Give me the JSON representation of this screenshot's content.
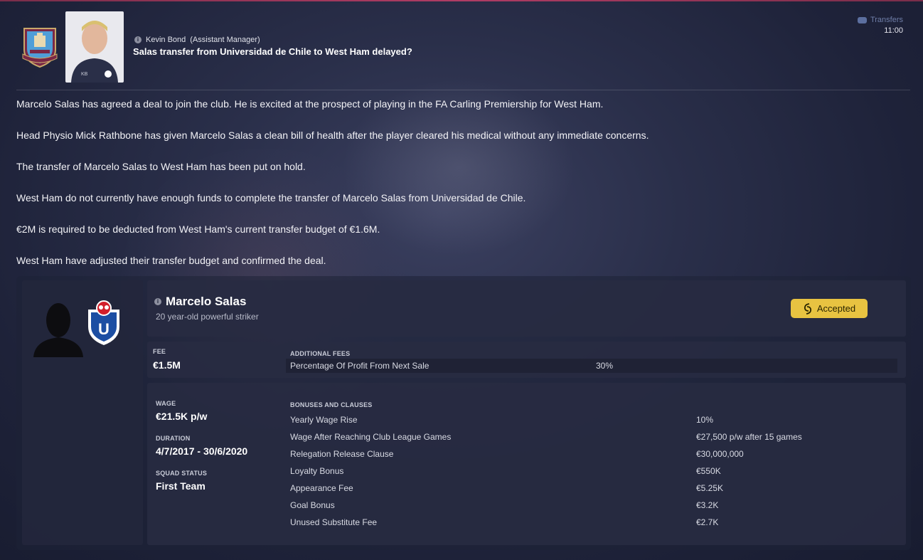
{
  "header": {
    "author_name": "Kevin Bond",
    "author_role": "(Assistant Manager)",
    "headline": "Salas transfer from Universidad de Chile to West Ham delayed?",
    "category": "Transfers",
    "time": "11:00",
    "club_badge_text": "WEST HAM UNITED",
    "staff_initials": "KB"
  },
  "body": {
    "paragraphs": [
      "Marcelo Salas has agreed a deal to join the club. He is excited at the prospect of playing in the FA Carling Premiership for West Ham.",
      "Head Physio Mick Rathbone has given Marcelo Salas a clean bill of health after the player cleared his medical without any immediate concerns.",
      "The transfer of Marcelo Salas to West Ham has been put on hold.",
      "West Ham do not currently have enough funds to complete the transfer of Marcelo Salas from Universidad de Chile.",
      "€2M is required to be deducted from West Ham's current transfer budget of €1.6M.",
      "West Ham have adjusted their transfer budget and confirmed the deal."
    ]
  },
  "player": {
    "name": "Marcelo Salas",
    "description": "20 year-old powerful striker",
    "status": "Accepted",
    "club_badge_letter": "U"
  },
  "fee": {
    "fee_label": "FEE",
    "fee_value": "€1.5M",
    "additional_label": "ADDITIONAL FEES",
    "additional_item": "Percentage Of Profit From Next Sale",
    "additional_value": "30%"
  },
  "contract": {
    "wage_label": "WAGE",
    "wage_value": "€21.5K p/w",
    "duration_label": "DURATION",
    "duration_value": "4/7/2017 - 30/6/2020",
    "squad_label": "SQUAD STATUS",
    "squad_value": "First Team",
    "clauses_label": "BONUSES AND CLAUSES",
    "clauses": [
      {
        "label": "Yearly Wage Rise",
        "value": "10%"
      },
      {
        "label": "Wage After Reaching Club League Games",
        "value": "€27,500 p/w after 15 games"
      },
      {
        "label": "Relegation Release Clause",
        "value": "€30,000,000"
      },
      {
        "label": "Loyalty Bonus",
        "value": "€550K"
      },
      {
        "label": "Appearance Fee",
        "value": "€5.25K"
      },
      {
        "label": "Goal Bonus",
        "value": "€3.2K"
      },
      {
        "label": "Unused Substitute Fee",
        "value": "€2.7K"
      }
    ]
  },
  "colors": {
    "accent_pill": "#e8c341",
    "background": "#1e2239",
    "category_text": "#6f7ea8"
  }
}
